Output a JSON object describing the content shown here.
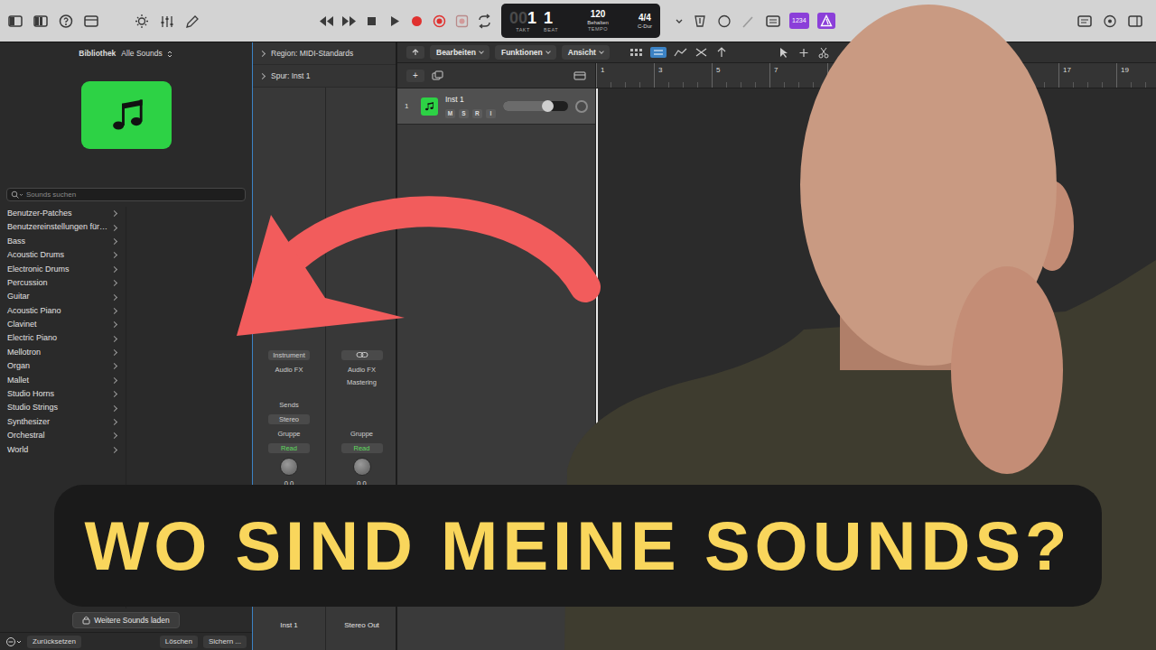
{
  "toolbar": {
    "lcd": {
      "bar_dim": "00",
      "bar": "1",
      "beat": "1",
      "bar_label": "TAKT",
      "beat_label": "BEAT",
      "tempo": "120",
      "tempo_mode": "Behalten",
      "tempo_label": "TEMPO",
      "signature": "4/4",
      "key": "C-Dur"
    },
    "count_in": "1234"
  },
  "library": {
    "title": "Bibliothek",
    "filter": "Alle Sounds",
    "search": {
      "placeholder": "Sounds suchen"
    },
    "categories": [
      {
        "label": "Benutzer-Patches",
        "selected": false
      },
      {
        "label": "Benutzereinstellungen für…",
        "selected": false
      },
      {
        "label": "Bass",
        "selected": false
      },
      {
        "label": "Acoustic Drums",
        "selected": false
      },
      {
        "label": "Electronic Drums",
        "selected": false
      },
      {
        "label": "Percussion",
        "selected": false
      },
      {
        "label": "Guitar",
        "selected": false
      },
      {
        "label": "Acoustic Piano",
        "selected": false
      },
      {
        "label": "Clavinet",
        "selected": false
      },
      {
        "label": "Electric Piano",
        "selected": false
      },
      {
        "label": "Mellotron",
        "selected": false
      },
      {
        "label": "Organ",
        "selected": false
      },
      {
        "label": "Mallet",
        "selected": false
      },
      {
        "label": "Studio Horns",
        "selected": false
      },
      {
        "label": "Studio Strings",
        "selected": false
      },
      {
        "label": "Synthesizer",
        "selected": false
      },
      {
        "label": "Orchestral",
        "selected": false
      },
      {
        "label": "World",
        "selected": false
      }
    ],
    "load_more": "Weitere Sounds laden",
    "footer": {
      "reset": "Zurücksetzen",
      "delete": "Löschen",
      "save": "Sichern ..."
    }
  },
  "inspector": {
    "region": "Region: MIDI-Standards",
    "track": "Spur: Inst 1",
    "strips": [
      {
        "kind": "instrument",
        "input": "Instrument",
        "fx": "Audio FX",
        "sends": "Sends",
        "output": "Stereo",
        "group": "Gruppe",
        "automation": "Read",
        "value": "0,0",
        "name": "Inst 1"
      },
      {
        "kind": "output",
        "fx": "Audio FX",
        "plugin": "Mastering",
        "group": "Gruppe",
        "automation": "Read",
        "value": "0,0",
        "name": "Stereo Out"
      }
    ]
  },
  "tracks": {
    "menus": [
      "Bearbeiten",
      "Funktionen",
      "Ansicht"
    ],
    "add": "+",
    "ruler": [
      "1",
      "3",
      "5",
      "7",
      "17",
      "19"
    ],
    "rows": [
      {
        "number": "1",
        "name": "Inst 1",
        "selected": true,
        "buttons": [
          {
            "label": "M",
            "on": false
          },
          {
            "label": "S",
            "on": false
          },
          {
            "label": "R",
            "on": false
          },
          {
            "label": "I",
            "on": false
          }
        ],
        "volume": {
          "level": 0.7
        }
      }
    ]
  },
  "caption": "WO SIND MEINE SOUNDS?"
}
